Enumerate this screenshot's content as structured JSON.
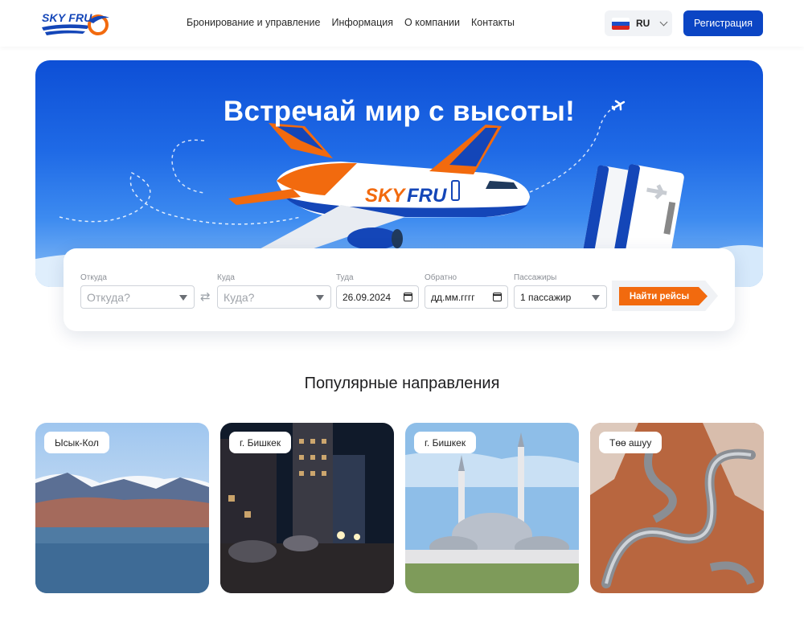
{
  "header": {
    "logo_text": "SKY FRU",
    "nav": [
      "Бронирование и управление",
      "Информация",
      "О компании",
      "Контакты"
    ],
    "language": "RU",
    "register_label": "Регистрация"
  },
  "hero": {
    "title": "Встречай мир с высоты!",
    "plane_brand": "SKY FRU"
  },
  "search": {
    "from": {
      "label": "Откуда",
      "placeholder": "Откуда?"
    },
    "to": {
      "label": "Куда",
      "placeholder": "Куда?"
    },
    "depart": {
      "label": "Туда",
      "value": "26.09.2024"
    },
    "return": {
      "label": "Обратно",
      "value": "дд.мм.гггг"
    },
    "passengers": {
      "label": "Пассажиры",
      "value": "1 пассажир"
    },
    "find_label": "Найти рейсы"
  },
  "popular": {
    "title": "Популярные направления",
    "cards": [
      {
        "label": "Ысык-Кол"
      },
      {
        "label": "г. Бишкек"
      },
      {
        "label": "г. Бишкек"
      },
      {
        "label": "Төө ашуу"
      }
    ]
  },
  "colors": {
    "brand_blue": "#0b45c4",
    "accent_orange": "#f26a0e"
  }
}
